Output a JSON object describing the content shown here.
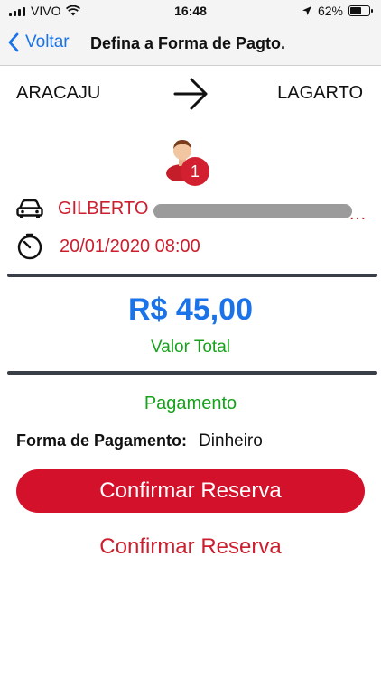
{
  "status_bar": {
    "carrier": "VIVO",
    "time": "16:48",
    "battery": "62%"
  },
  "nav": {
    "back_label": "Voltar",
    "title": "Defina a Forma de Pagto."
  },
  "route": {
    "origin": "ARACAJU",
    "destination": "LAGARTO"
  },
  "passengers": {
    "count": "1"
  },
  "trip": {
    "driver": "GILBERTO",
    "datetime": "20/01/2020 08:00"
  },
  "totals": {
    "value": "R$ 45,00",
    "label": "Valor Total"
  },
  "payment": {
    "title": "Pagamento",
    "method_label": "Forma de Pagamento:",
    "method_value": "Dinheiro"
  },
  "actions": {
    "confirm_primary": "Confirmar Reserva",
    "confirm_secondary": "Confirmar Reserva"
  },
  "colors": {
    "accent_blue": "#1a73e8",
    "accent_red": "#d4112a",
    "accent_green": "#17a21b"
  }
}
